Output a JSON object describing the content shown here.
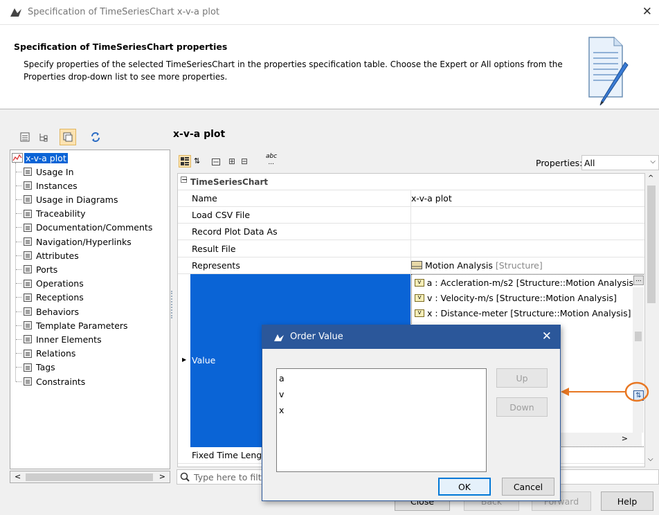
{
  "window": {
    "title": "Specification of TimeSeriesChart x-v-a plot",
    "close_glyph": "✕"
  },
  "header": {
    "heading": "Specification of TimeSeriesChart properties",
    "description": "Specify properties of the selected TimeSeriesChart in the properties specification table. Choose the Expert or All options from the Properties drop-down list to see more properties."
  },
  "tree": {
    "root": "x-v-a plot",
    "items": [
      "Usage In",
      "Instances",
      "Usage in Diagrams",
      "Traceability",
      "Documentation/Comments",
      "Navigation/Hyperlinks",
      "Attributes",
      "Ports",
      "Operations",
      "Receptions",
      "Behaviors",
      "Template Parameters",
      "Inner Elements",
      "Relations",
      "Tags",
      "Constraints"
    ]
  },
  "panel": {
    "title": "x-v-a plot",
    "properties_label": "Properties:",
    "properties_value": "All",
    "abc_icon": "abc\n...",
    "group": "TimeSeriesChart",
    "rows": [
      {
        "name": "Name",
        "value": "x-v-a plot"
      },
      {
        "name": "Load CSV File",
        "value": ""
      },
      {
        "name": "Record Plot Data As",
        "value": ""
      },
      {
        "name": "Result File",
        "value": ""
      },
      {
        "name": "Represents",
        "value": "Motion Analysis",
        "value_suffix": "[Structure]"
      }
    ],
    "value_row": {
      "name": "Value",
      "items": [
        "a : Accleration-m/s2 [Structure::Motion Analysis",
        "v : Velocity-m/s [Structure::Motion Analysis]",
        "x : Distance-meter [Structure::Motion Analysis]"
      ]
    },
    "fixed_row": "Fixed Time Lengt",
    "filter_placeholder": "Type here to filt"
  },
  "dialog": {
    "title": "Order Value",
    "items": [
      "a",
      "v",
      "x"
    ],
    "up": "Up",
    "down": "Down",
    "ok": "OK",
    "cancel": "Cancel"
  },
  "bottom": {
    "close": "Close",
    "back": "Back",
    "forward": "Forward",
    "help": "Help"
  },
  "colors": {
    "selection": "#0a64d6",
    "dialog_header": "#2b579a",
    "callout": "#e87722"
  }
}
